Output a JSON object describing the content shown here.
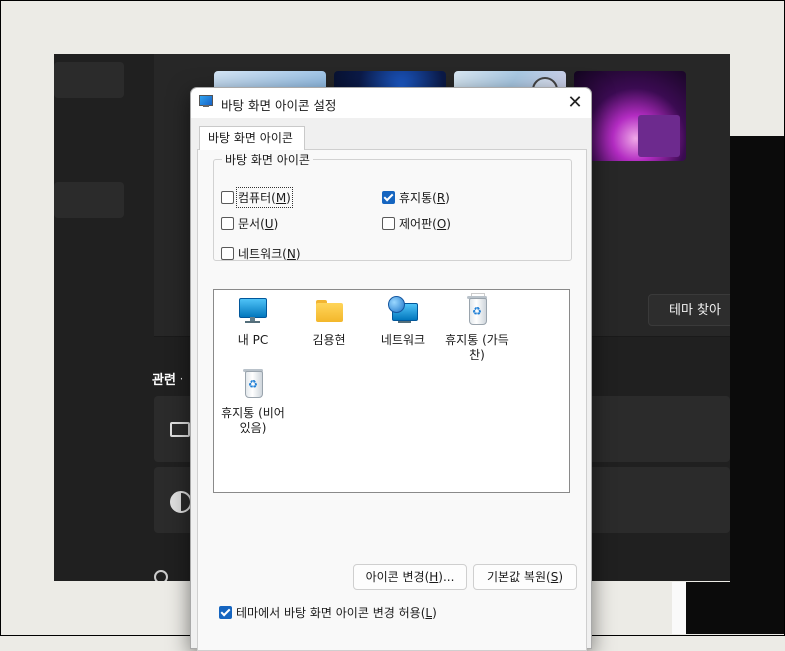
{
  "background": {
    "find_theme_label": "테마 찾아",
    "related_settings_title": "관련 설정"
  },
  "dialog": {
    "title": "바탕 화면 아이콘 설정",
    "tab_label": "바탕 화면 아이콘",
    "group_title": "바탕 화면 아이콘",
    "checkboxes": {
      "computer": {
        "label": "컴퓨터",
        "key": "M",
        "checked": false
      },
      "recycle_bin": {
        "label": "휴지통",
        "key": "R",
        "checked": true
      },
      "documents": {
        "label": "문서",
        "key": "U",
        "checked": false
      },
      "control_panel": {
        "label": "제어판",
        "key": "O",
        "checked": false
      },
      "network": {
        "label": "네트워크",
        "key": "N",
        "checked": false
      }
    },
    "icons": [
      {
        "label": "내 PC",
        "icon": "monitor-icon"
      },
      {
        "label": "김용현",
        "icon": "folder-icon"
      },
      {
        "label": "네트워크",
        "icon": "network-icon"
      },
      {
        "label": "휴지통 (가득 찬)",
        "icon": "recycle-bin-full-icon"
      },
      {
        "label": "휴지통 (비어 있음)",
        "icon": "recycle-bin-empty-icon"
      }
    ],
    "buttons": {
      "change_icon": {
        "label": "아이콘 변경",
        "key": "H",
        "suffix": "..."
      },
      "restore_default": {
        "label": "기본값 복원",
        "key": "S"
      }
    },
    "allow_themes": {
      "label": "테마에서 바탕 화면 아이콘 변경 허용",
      "key": "L",
      "checked": true
    }
  }
}
